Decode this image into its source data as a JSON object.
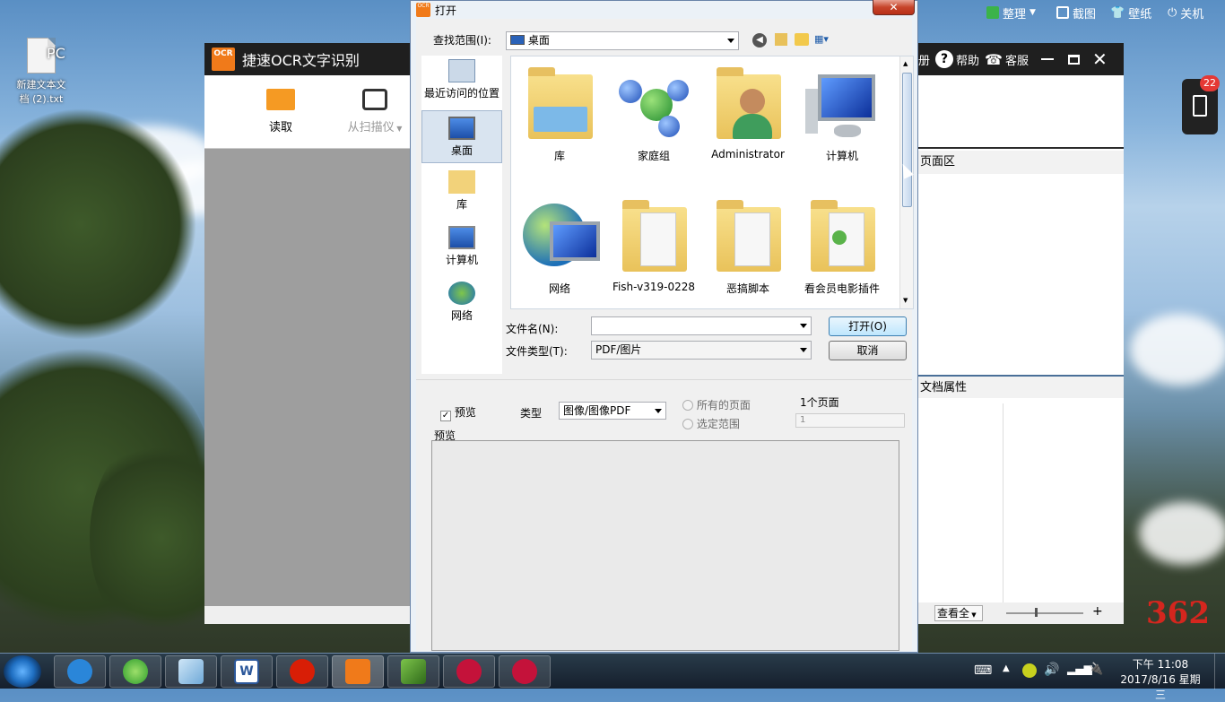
{
  "desktop": {
    "icon_label": "新建文本文\n档 (2).txt",
    "top_tools": [
      "整理",
      "截图",
      "壁纸",
      "关机"
    ],
    "watermark_number": "362",
    "pc_text": "PC",
    "battery_badge": "22"
  },
  "ocr_app": {
    "title": "捷速OCR文字识别",
    "logo_text": "OCR",
    "toolbar": {
      "read": "读取",
      "scanner": "从扫描仪"
    },
    "right_header": {
      "register_partial": "册",
      "help": "帮助",
      "service": "客服"
    },
    "panels": {
      "page_area": "页面区",
      "doc_props": "文档属性"
    },
    "bottom": {
      "view_all": "查看全"
    }
  },
  "dialog": {
    "title": "打开",
    "look_in_label": "查找范围(I):",
    "look_in_value": "桌面",
    "places": [
      "最近访问的位置",
      "桌面",
      "库",
      "计算机",
      "网络"
    ],
    "files": [
      "库",
      "家庭组",
      "Administrator",
      "计算机",
      "网络",
      "Fish-v319-0228",
      "恶搞脚本",
      "看会员电影插件"
    ],
    "filename_label": "文件名(N):",
    "filename_value": "",
    "filetype_label": "文件类型(T):",
    "filetype_value": "PDF/图片",
    "open_button": "打开(O)",
    "cancel_button": "取消",
    "preview_check": "预览",
    "type_label": "类型",
    "type_value": "图像/图像PDF",
    "all_pages": "所有的页面",
    "select_range": "选定范围",
    "page_count": "1个页面",
    "range_value": "1",
    "preview_group": "预览"
  },
  "taskbar": {
    "time": "下午 11:08",
    "date": "2017/8/16 星期三"
  },
  "colors": {
    "accent": "#f07a1a",
    "dialog_border": "#6a84a8",
    "taskbar": "#1c2a3a"
  }
}
